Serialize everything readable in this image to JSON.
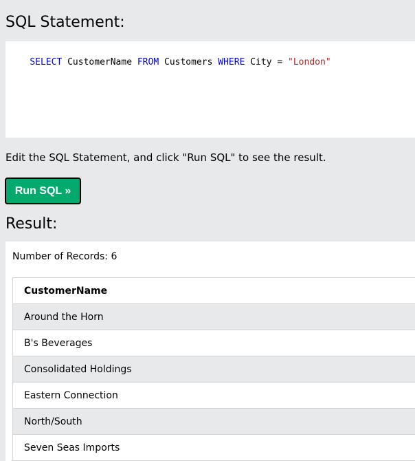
{
  "sql_section": {
    "heading": "SQL Statement:",
    "query_tokens": [
      {
        "text": "SELECT",
        "type": "keyword"
      },
      {
        "text": " CustomerName ",
        "type": "plain"
      },
      {
        "text": "FROM",
        "type": "keyword"
      },
      {
        "text": " Customers ",
        "type": "plain"
      },
      {
        "text": "WHERE",
        "type": "keyword"
      },
      {
        "text": " City = ",
        "type": "plain"
      },
      {
        "text": "\"London\"",
        "type": "string"
      }
    ]
  },
  "instructions": "Edit the SQL Statement, and click \"Run SQL\" to see the result.",
  "run_button": {
    "label": "Run SQL »"
  },
  "result_section": {
    "heading": "Result:",
    "record_count": "Number of Records: 6",
    "table": {
      "columns": [
        "CustomerName"
      ],
      "rows": [
        [
          "Around the Horn"
        ],
        [
          "B's Beverages"
        ],
        [
          "Consolidated Holdings"
        ],
        [
          "Eastern Connection"
        ],
        [
          "North/South"
        ],
        [
          "Seven Seas Imports"
        ]
      ]
    }
  },
  "colors": {
    "page_bg": "#e7e9eb",
    "button_bg": "#04aa6d",
    "sql_keyword": "#0000cd",
    "sql_string": "#a52a2a",
    "striped_row": "#e7e9eb"
  }
}
